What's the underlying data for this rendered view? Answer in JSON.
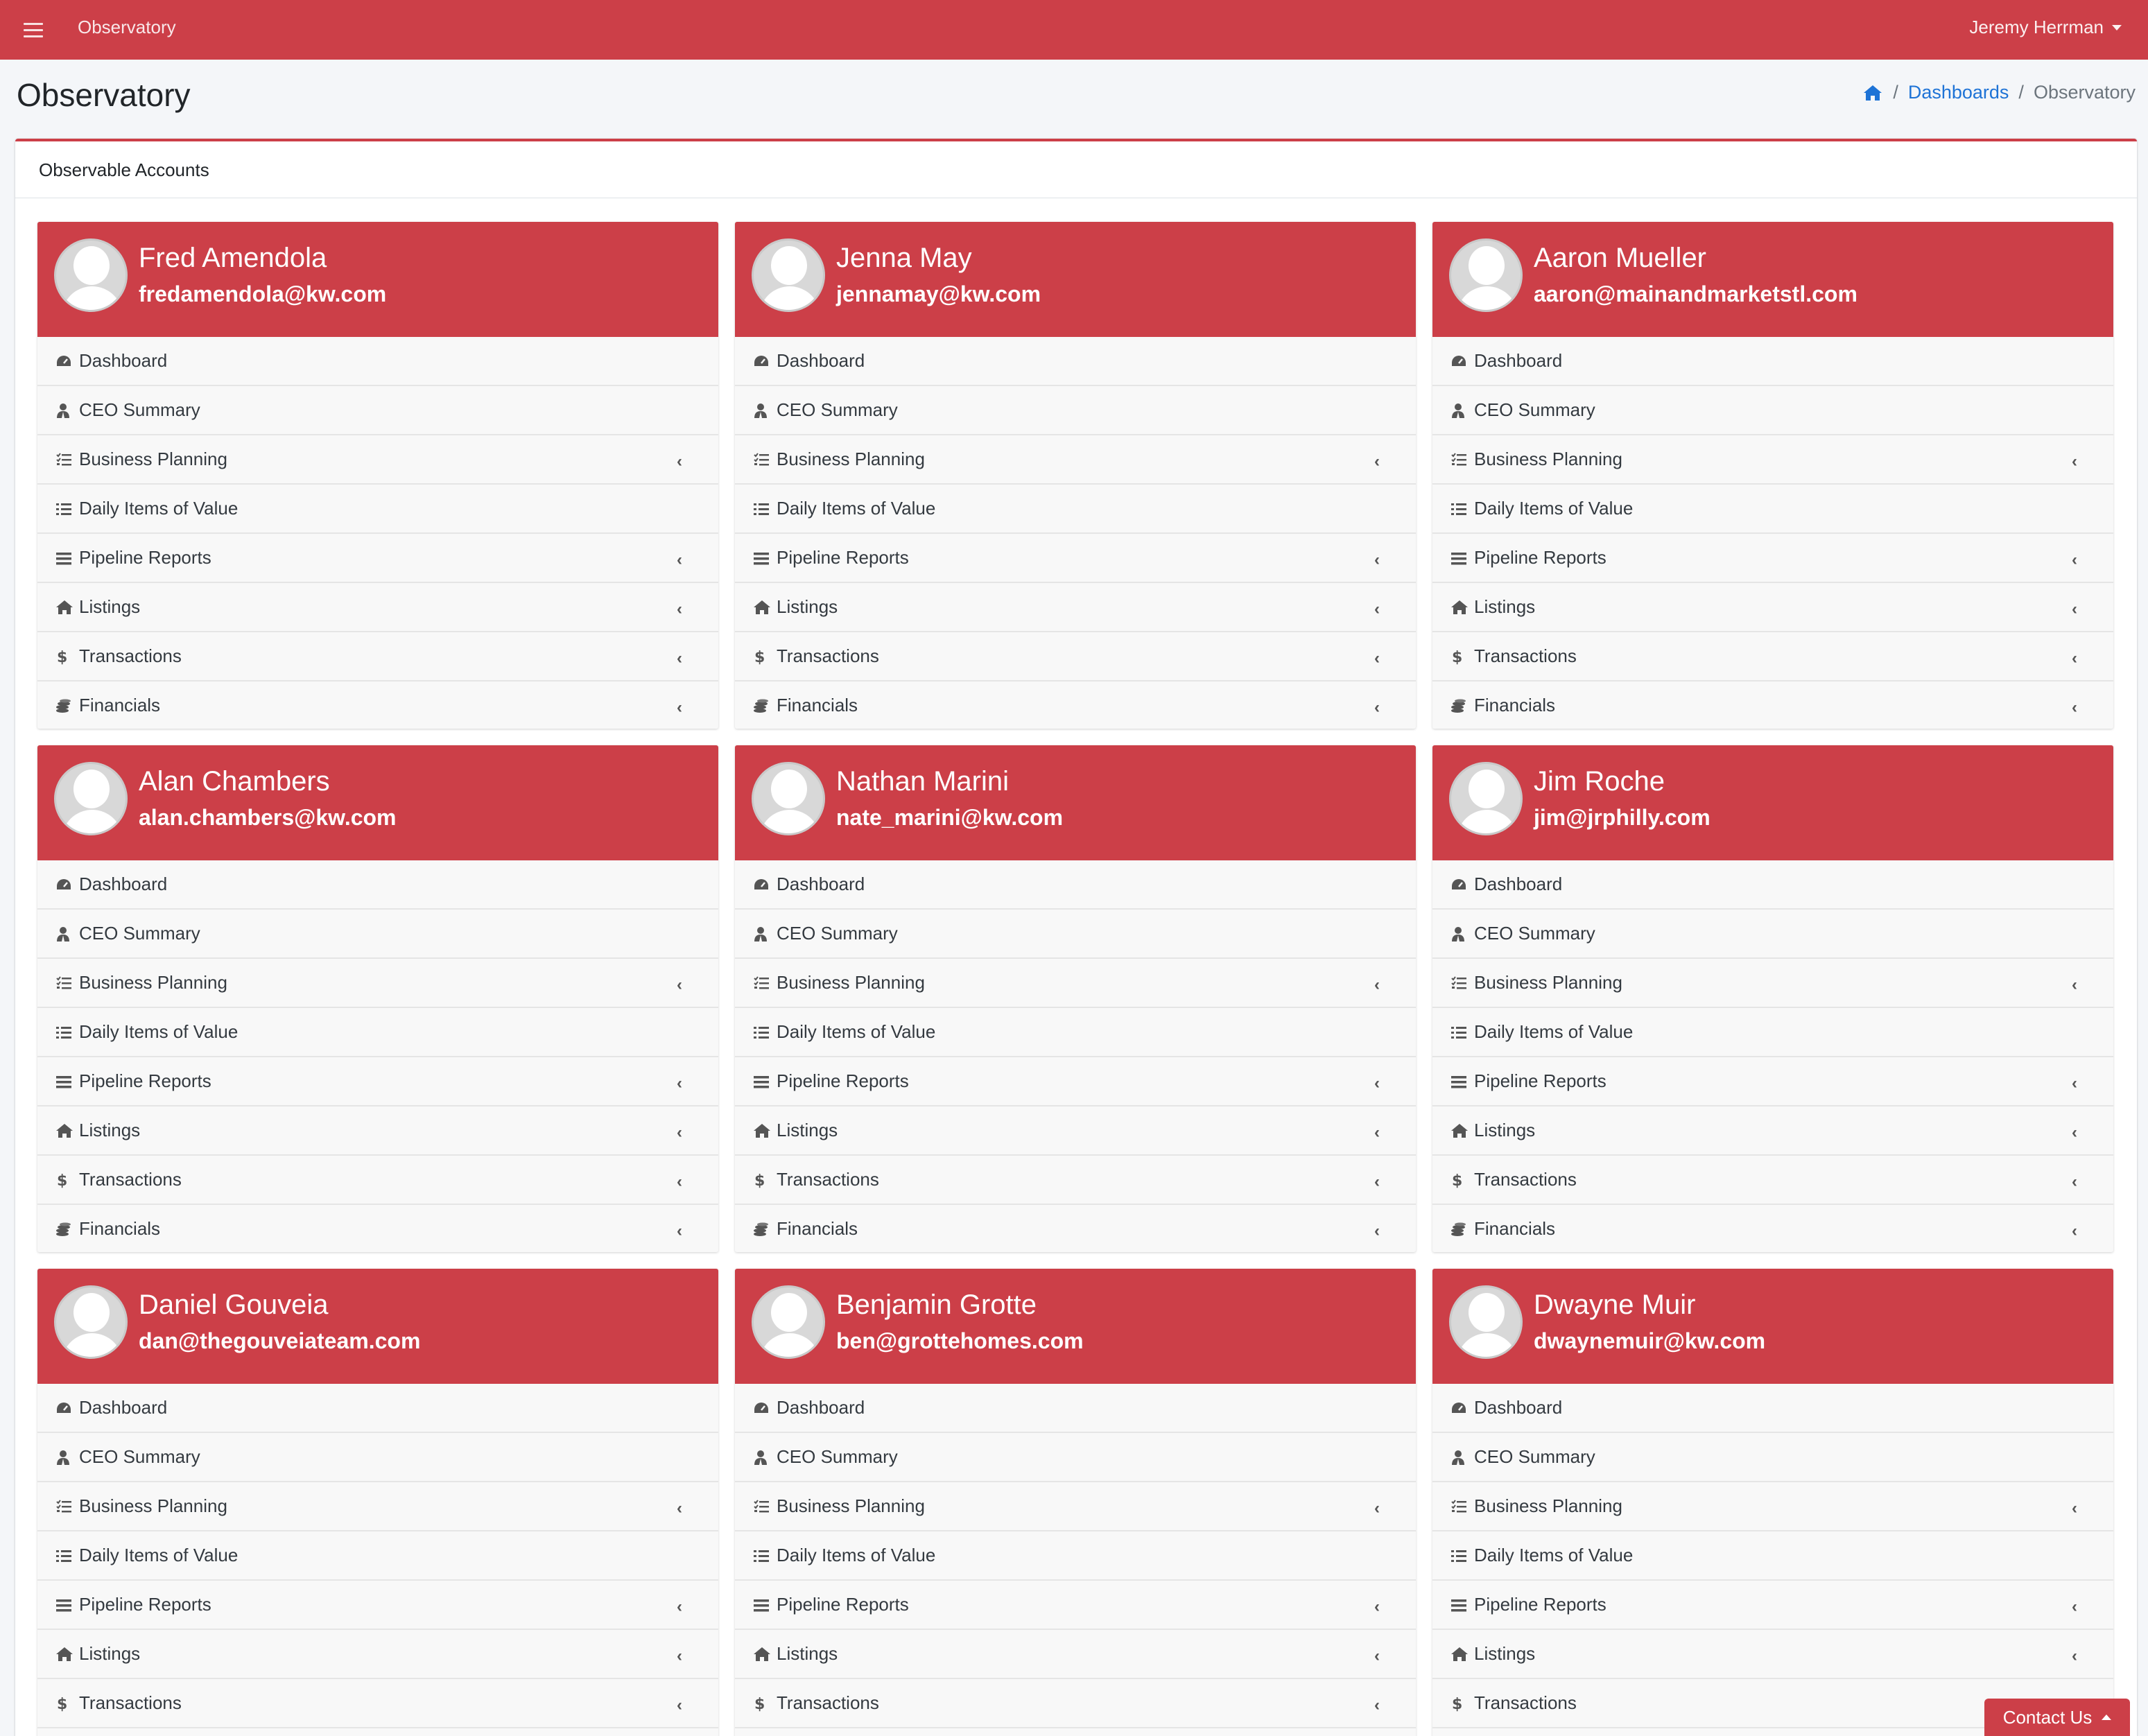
{
  "navbar": {
    "title": "Observatory",
    "user": "Jeremy Herrman"
  },
  "page": {
    "title": "Observatory"
  },
  "breadcrumb": {
    "dashboards": "Dashboards",
    "current": "Observatory",
    "separator": "/"
  },
  "section": {
    "title": "Observable Accounts"
  },
  "menu_items": [
    {
      "label": "Dashboard",
      "icon": "tachometer-icon",
      "has_chevron": false
    },
    {
      "label": "CEO Summary",
      "icon": "user-tie-icon",
      "has_chevron": false
    },
    {
      "label": "Business Planning",
      "icon": "tasks-icon",
      "has_chevron": true
    },
    {
      "label": "Daily Items of Value",
      "icon": "list-icon",
      "has_chevron": false
    },
    {
      "label": "Pipeline Reports",
      "icon": "bars-icon",
      "has_chevron": true
    },
    {
      "label": "Listings",
      "icon": "home-icon",
      "has_chevron": true
    },
    {
      "label": "Transactions",
      "icon": "dollar-icon",
      "has_chevron": true
    },
    {
      "label": "Financials",
      "icon": "coins-icon",
      "has_chevron": true
    }
  ],
  "accounts": [
    {
      "name": "Fred Amendola",
      "email": "fredamendola@kw.com"
    },
    {
      "name": "Jenna May",
      "email": "jennamay@kw.com"
    },
    {
      "name": "Aaron Mueller",
      "email": "aaron@mainandmarketstl.com"
    },
    {
      "name": "Alan Chambers",
      "email": "alan.chambers@kw.com"
    },
    {
      "name": "Nathan Marini",
      "email": "nate_marini@kw.com"
    },
    {
      "name": "Jim Roche",
      "email": "jim@jrphilly.com"
    },
    {
      "name": "Daniel Gouveia",
      "email": "dan@thegouveiateam.com"
    },
    {
      "name": "Benjamin Grotte",
      "email": "ben@grottehomes.com"
    },
    {
      "name": "Dwayne Muir",
      "email": "dwaynemuir@kw.com"
    }
  ],
  "contact": {
    "label": "Contact Us"
  },
  "colors": {
    "brand": "#cc3f48",
    "link": "#1e73d6"
  }
}
